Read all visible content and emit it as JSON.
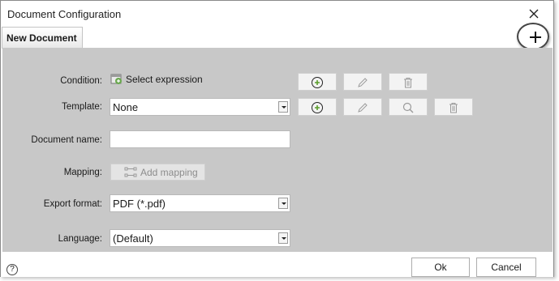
{
  "window": {
    "title": "Document Configuration"
  },
  "tabs": [
    {
      "label": "New Document"
    }
  ],
  "form": {
    "condition": {
      "label": "Condition:",
      "value": "Select expression"
    },
    "template": {
      "label": "Template:",
      "value": "None"
    },
    "document_name": {
      "label": "Document name:",
      "value": ""
    },
    "mapping": {
      "label": "Mapping:",
      "button_label": "Add mapping"
    },
    "export_format": {
      "label": "Export format:",
      "value": "PDF (*.pdf)"
    },
    "language": {
      "label": "Language:",
      "value": "(Default)"
    }
  },
  "footer": {
    "ok_label": "Ok",
    "cancel_label": "Cancel",
    "help_glyph": "?"
  },
  "icons": {
    "close": "close-icon",
    "add_tab": "plus-icon",
    "condition_expr": "expression-icon",
    "add": "add-circle-icon",
    "edit": "pencil-icon",
    "delete": "trash-icon",
    "search": "magnifier-icon",
    "mapping": "mapping-icon",
    "help": "help-icon",
    "dropdown": "chevron-down-icon"
  },
  "colors": {
    "panel_bg": "#c8c8c8",
    "add_icon_green": "#5a9e2b",
    "highlight_circle": "#444444"
  }
}
